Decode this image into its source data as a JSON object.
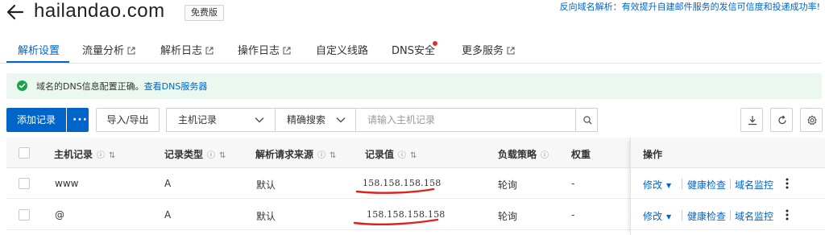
{
  "header": {
    "title": "hailandao.com",
    "edition": "免费版",
    "promo": "反向域名解析：有效提升自建邮件服务的发信可信度和投递成功率!"
  },
  "tabs": [
    {
      "label": "解析设置",
      "active": true
    },
    {
      "label": "流量分析",
      "external": true
    },
    {
      "label": "解析日志",
      "external": true
    },
    {
      "label": "操作日志",
      "external": true
    },
    {
      "label": "自定义线路"
    },
    {
      "label": "DNS安全",
      "dot": true
    },
    {
      "label": "更多服务",
      "external": true
    }
  ],
  "notice": {
    "text": "域名的DNS信息配置正确。",
    "link": "查看DNS服务器"
  },
  "toolbar": {
    "add_record": "添加记录",
    "import_export": "导入/导出",
    "field_select": "主机记录",
    "mode_select": "精确搜索",
    "search_placeholder": "请输入主机记录"
  },
  "table": {
    "columns": {
      "host": "主机记录",
      "type": "记录类型",
      "line": "解析请求来源",
      "value": "记录值",
      "strategy": "负载策略",
      "weight": "权重",
      "ops": "操作"
    },
    "sort_symbol": "⇅",
    "rows": [
      {
        "host": "www",
        "type": "A",
        "line": "默认",
        "value": "158.158.158.158",
        "strategy": "轮询",
        "weight": "-"
      },
      {
        "host": "@",
        "type": "A",
        "line": "默认",
        "value": "158.158.158.158",
        "strategy": "轮询",
        "weight": "-"
      }
    ],
    "ops": {
      "modify": "修改",
      "health_check": "健康检查",
      "domain_monitor": "域名监控"
    }
  },
  "colors": {
    "accent": "#0064c8",
    "notice_bg": "#ebf8ef",
    "success": "#1aa34a",
    "dot": "#e0302e",
    "annotation": "#e0201c"
  },
  "icons": [
    "back-arrow-icon",
    "external-link-icon",
    "check-circle-icon",
    "more-dots-icon",
    "chevron-down-icon",
    "search-icon",
    "download-icon",
    "refresh-icon",
    "settings-icon",
    "kebab-icon"
  ]
}
